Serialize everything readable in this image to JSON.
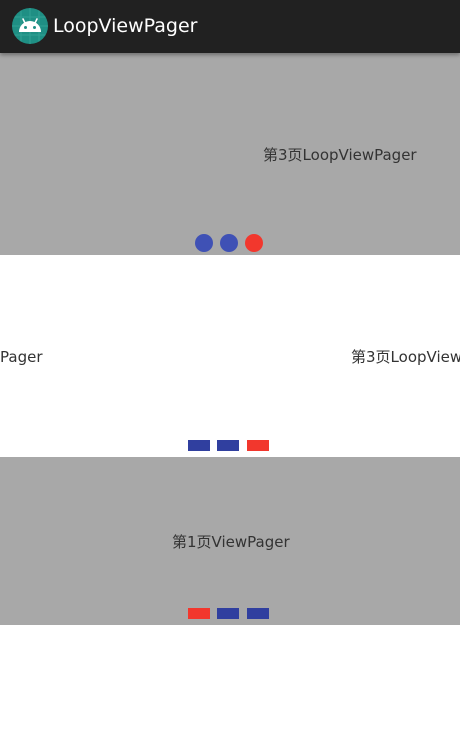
{
  "colors": {
    "app_bar": "#212121",
    "pager_gray": "#a8a8a8",
    "indicator_active": "#f2372d",
    "indicator_circle_inactive": "#3f51b5",
    "indicator_bar_inactive": "#303f9f"
  },
  "app_bar": {
    "icon": "android-icon",
    "title": "LoopViewPager"
  },
  "pager_1": {
    "page_text": "第3页LoopViewPager",
    "indicator_style": "circle",
    "indicator_count": 3,
    "active_index": 2
  },
  "pager_2": {
    "left_text": "Pager",
    "right_text": "第3页LoopView",
    "indicator_style": "bar",
    "indicator_count": 3,
    "active_index": 2
  },
  "pager_3": {
    "page_text": "第1页ViewPager",
    "indicator_style": "bar",
    "indicator_count": 3,
    "active_index": 0
  }
}
